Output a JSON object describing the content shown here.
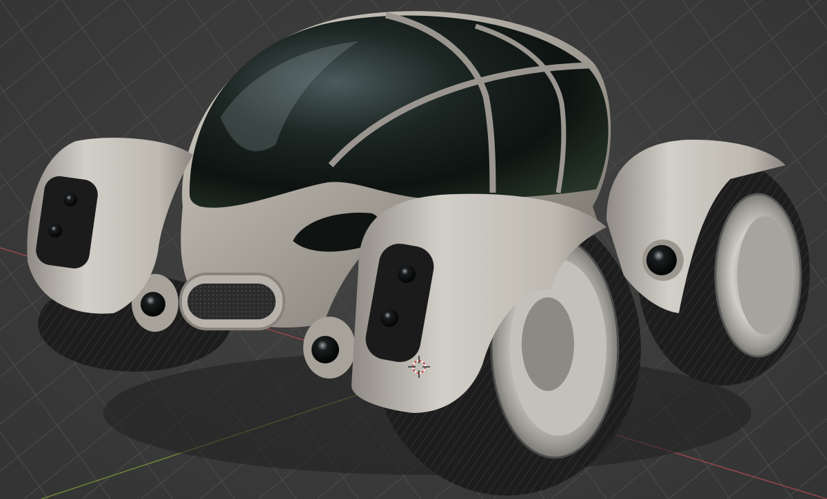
{
  "viewport": {
    "background_color": "#3b3b3b",
    "grid_color": "#4a4a4a",
    "x_axis_color": "#b04a52",
    "y_axis_color": "#7a9a3a"
  },
  "scene_object": {
    "body_color": "#a9a49b",
    "glass_color": "#0e1412",
    "tire_color": "#1b1b1b",
    "rim_color": "#b8b6b0"
  },
  "cursor_3d": {
    "icon": "crosshair-icon",
    "color_primary": "#d24040",
    "color_secondary": "#ffffff"
  }
}
